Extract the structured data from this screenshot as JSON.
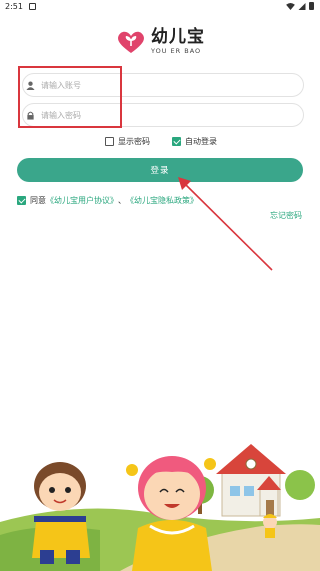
{
  "status_bar": {
    "time": "2:51"
  },
  "logo": {
    "name_cn": "幼儿宝",
    "name_en": "YOU ER BAO"
  },
  "form": {
    "account_placeholder": "请输入账号",
    "password_placeholder": "请输入密码",
    "show_password_label": "显示密码",
    "show_password_checked": false,
    "auto_login_label": "自动登录",
    "auto_login_checked": true,
    "login_button": "登录"
  },
  "agreement": {
    "checked": true,
    "prefix": "同意",
    "user_agreement": "《幼儿宝用户协议》",
    "separator": "、",
    "privacy_policy": "《幼儿宝隐私政策》"
  },
  "forgot_password": "忘记密码",
  "colors": {
    "brand_green": "#3aa68b",
    "link_green": "#2aa77e",
    "annotation_red": "#d9363e"
  }
}
